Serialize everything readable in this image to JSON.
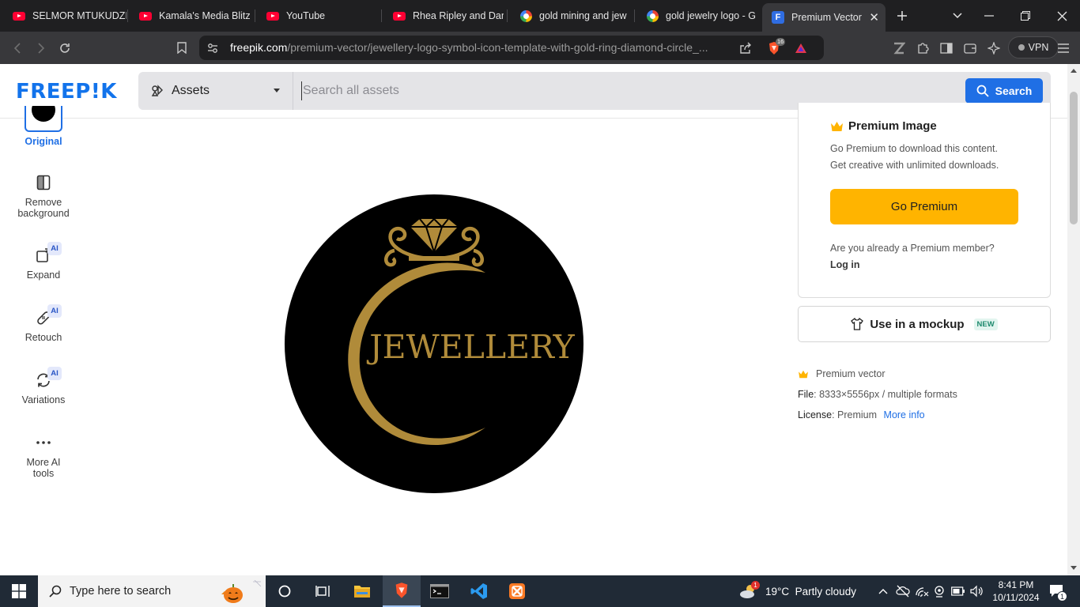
{
  "browser": {
    "tabs": [
      {
        "title": "SELMOR MTUKUDZI",
        "icon": "youtube-icon"
      },
      {
        "title": "Kamala's Media Blitz",
        "icon": "youtube-icon"
      },
      {
        "title": "YouTube",
        "icon": "youtube-icon"
      },
      {
        "title": "Rhea Ripley and Dam",
        "icon": "youtube-icon"
      },
      {
        "title": "gold mining and jew",
        "icon": "google-icon"
      },
      {
        "title": "gold jewelry logo - G",
        "icon": "google-icon"
      },
      {
        "title": "Premium Vector",
        "icon": "freepik-icon",
        "active": true
      }
    ],
    "url_host": "freepik.com",
    "url_path": "/premium-vector/jewellery-logo-symbol-icon-template-with-gold-ring-diamond-circle_...",
    "shield_badge": "16",
    "vpn_label": "VPN"
  },
  "header": {
    "logo": "FREEP!K",
    "asset_filter": "Assets",
    "search_placeholder": "Search all assets",
    "search_button": "Search"
  },
  "tools": {
    "original": "Original",
    "remove_bg": "Remove background",
    "expand": "Expand",
    "retouch": "Retouch",
    "variations": "Variations",
    "more_ai": "More AI tools",
    "ai_badge": "AI"
  },
  "image": {
    "logo_text": "JEWELLERY",
    "colors": {
      "background": "#000000",
      "gold": "#b08b3a"
    }
  },
  "premium": {
    "title": "Premium Image",
    "line1": "Go Premium to download this content.",
    "line2": "Get creative with unlimited downloads.",
    "button": "Go Premium",
    "member_question": "Are you already a Premium member?",
    "login": "Log in",
    "mockup": "Use in a mockup",
    "mockup_badge": "NEW",
    "accent": "#ffb400"
  },
  "meta": {
    "type": "Premium vector",
    "file_label": "File",
    "file_value": ": 8333×5556px / multiple formats",
    "license_label": "License",
    "license_value": ": Premium",
    "more_info": "More info"
  },
  "taskbar": {
    "search_placeholder": "Type here to search",
    "weather": "19°C  Partly cloudy",
    "weather_badge": "1",
    "time": "8:41 PM",
    "date": "10/11/2024",
    "notifications": "1"
  }
}
